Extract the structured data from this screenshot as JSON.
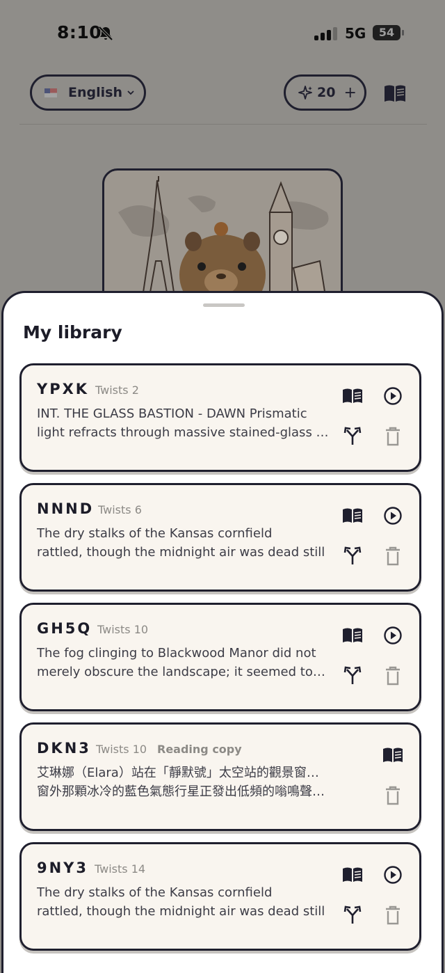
{
  "status_bar": {
    "time": "8:10",
    "network": "5G",
    "battery": "54"
  },
  "header": {
    "language": "English",
    "credits": "20",
    "credits_add": "+"
  },
  "library": {
    "title": "My library",
    "items": [
      {
        "code": "YPXK",
        "twists": "Twists 2",
        "badge": "",
        "line1": "INT. THE GLASS BASTION - DAWN Prismatic",
        "line2": "light refracts through massive stained-glass windows",
        "has_play": true,
        "has_branch": true
      },
      {
        "code": "NNND",
        "twists": "Twists 6",
        "badge": "",
        "line1": "The dry stalks of the Kansas cornfield",
        "line2": "rattled, though the midnight air was dead still",
        "has_play": true,
        "has_branch": true
      },
      {
        "code": "GH5Q",
        "twists": "Twists 10",
        "badge": "",
        "line1": "The fog clinging to Blackwood Manor did not",
        "line2": "merely obscure the landscape; it seemed to breathe",
        "has_play": true,
        "has_branch": true
      },
      {
        "code": "DKN3",
        "twists": "Twists 10",
        "badge": "Reading copy",
        "line1": "艾琳娜（Elara）站在「靜默號」太空站的觀景窗前，",
        "line2": "窗外那顆冰冷的藍色氣態行星正發出低頻的嗡鳴聲。深沉",
        "has_play": false,
        "has_branch": false
      },
      {
        "code": "9NY3",
        "twists": "Twists 14",
        "badge": "",
        "line1": "The dry stalks of the Kansas cornfield",
        "line2": "rattled, though the midnight air was dead still",
        "has_play": true,
        "has_branch": true
      }
    ]
  },
  "icons": {
    "read": "open-book-icon",
    "play": "play-circle-icon",
    "branch": "branch-fork-icon",
    "delete": "trash-icon",
    "credits": "sparkle-icon",
    "muted": "bell-slash-icon"
  },
  "colors": {
    "card_bg": "#f9f5ef",
    "outline": "#1f1f2e",
    "muted_text": "#8c8a86",
    "overlay": "#8f8d89"
  }
}
